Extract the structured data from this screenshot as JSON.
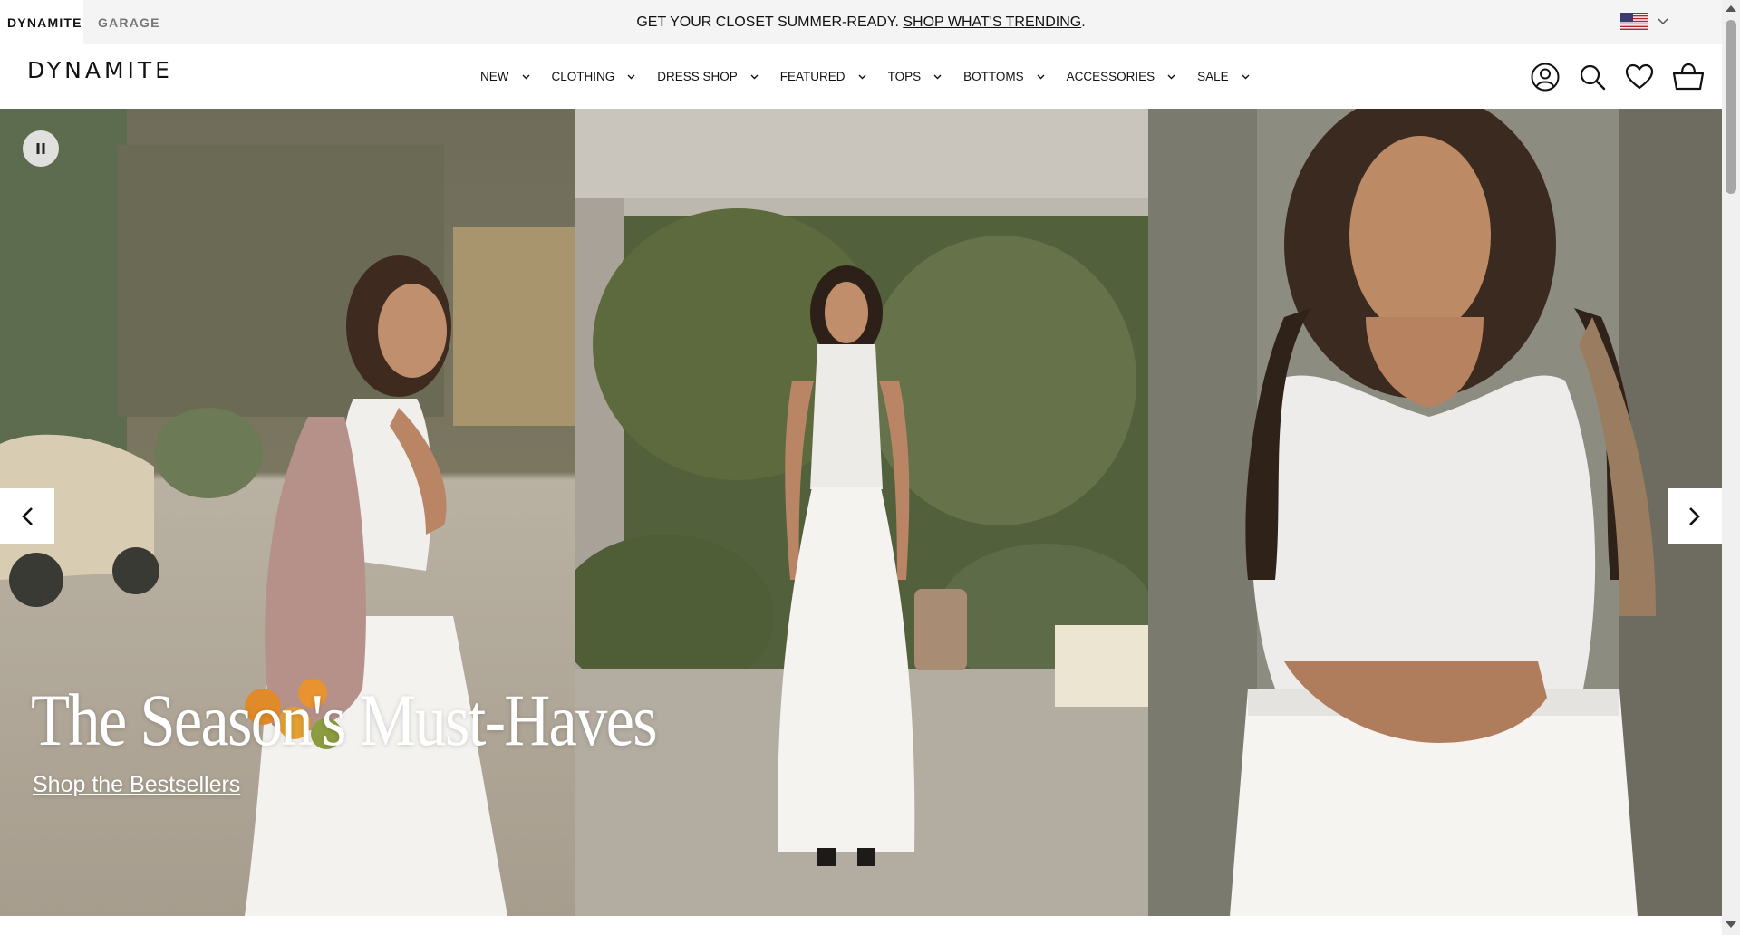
{
  "topbar": {
    "brands": [
      "DYNAMITE",
      "GARAGE"
    ],
    "promo_text": "GET YOUR CLOSET SUMMER-READY.",
    "promo_link": "SHOP WHAT'S TRENDING",
    "promo_suffix": ".",
    "locale_icon": "us-flag-icon"
  },
  "header": {
    "logo": "DYNAMITE",
    "nav": [
      "NEW",
      "CLOTHING",
      "DRESS SHOP",
      "FEATURED",
      "TOPS",
      "BOTTOMS",
      "ACCESSORIES",
      "SALE"
    ],
    "icons": [
      "account-icon",
      "search-icon",
      "wishlist-heart-icon",
      "shopping-basket-icon"
    ]
  },
  "hero": {
    "headline": "The Season's Must-Haves",
    "cta": "Shop the Bestsellers",
    "controls": [
      "pause-icon",
      "chevron-left-icon",
      "chevron-right-icon"
    ]
  },
  "colors": {
    "topbar_bg": "#f4f4f4",
    "text": "#111111",
    "hero_text": "#ffffff"
  }
}
